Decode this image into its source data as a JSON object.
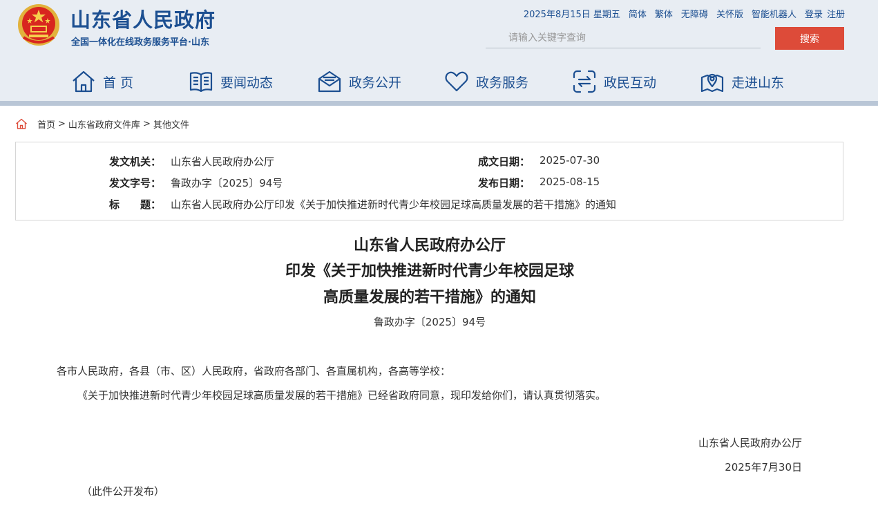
{
  "header": {
    "title": "山东省人民政府",
    "subtitle": "全国一体化在线政务服务平台·山东",
    "date": "2025年8月15日 星期五",
    "links": [
      "简体",
      "繁体",
      "无障碍",
      "关怀版",
      "智能机器人"
    ],
    "login": "登录",
    "register": "注册",
    "search_placeholder": "请输入关键字查询",
    "search_button": "搜索"
  },
  "nav": [
    {
      "label": "首 页",
      "icon": "home-icon"
    },
    {
      "label": "要闻动态",
      "icon": "book-icon"
    },
    {
      "label": "政务公开",
      "icon": "mail-icon"
    },
    {
      "label": "政务服务",
      "icon": "heart-icon"
    },
    {
      "label": "政民互动",
      "icon": "interact-icon"
    },
    {
      "label": "走进山东",
      "icon": "location-icon"
    }
  ],
  "breadcrumb": [
    "首页",
    "山东省政府文件库",
    "其他文件"
  ],
  "info": {
    "issuer_label": "发文机关：",
    "issuer": "山东省人民政府办公厅",
    "created_label": "成文日期：",
    "created": "2025-07-30",
    "doc_no_label": "发文字号：",
    "doc_no": "鲁政办字〔2025〕94号",
    "published_label": "发布日期：",
    "published": "2025-08-15",
    "title_label": "标　　题：",
    "title": "山东省人民政府办公厅印发《关于加快推进新时代青少年校园足球高质量发展的若干措施》的通知"
  },
  "document": {
    "title_lines": [
      "山东省人民政府办公厅",
      "印发《关于加快推进新时代青少年校园足球",
      "高质量发展的若干措施》的通知"
    ],
    "number": "鲁政办字〔2025〕94号",
    "recipients": "各市人民政府，各县（市、区）人民政府，省政府各部门、各直属机构，各高等学校：",
    "body": "《关于加快推进新时代青少年校园足球高质量发展的若干措施》已经省政府同意，现印发给你们，请认真贯彻落实。",
    "signature": "山东省人民政府办公厅",
    "date": "2025年7月30日",
    "note": "（此件公开发布）"
  },
  "colors": {
    "brand": "#1c4f91",
    "header_bg": "#e8edf3",
    "search_button": "#dd4b39"
  }
}
